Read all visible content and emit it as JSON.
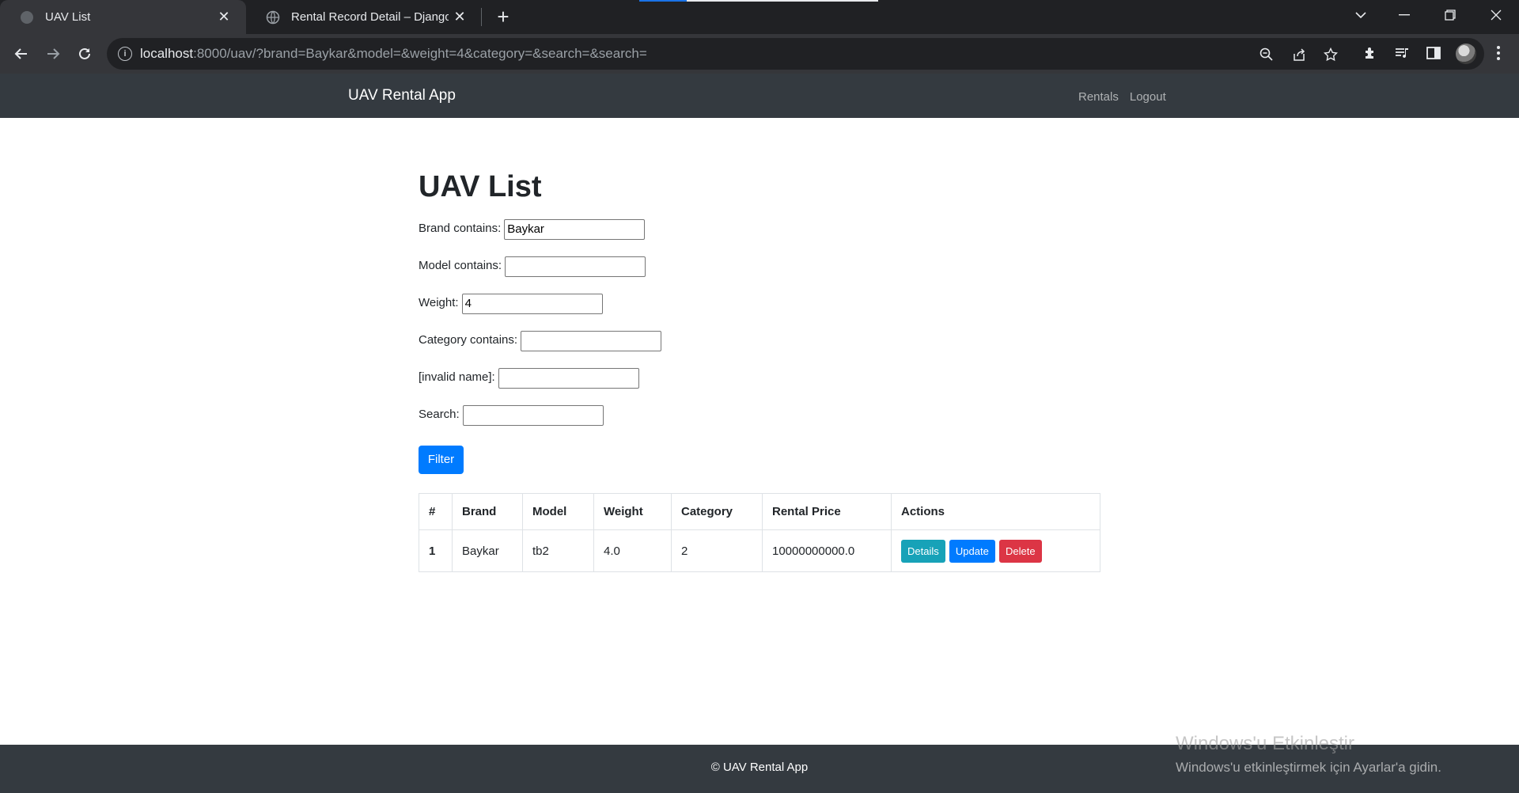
{
  "browser": {
    "tabs": [
      {
        "title": "UAV List"
      },
      {
        "title": "Rental Record Detail – Django RE"
      }
    ],
    "url_host": "localhost",
    "url_rest": ":8000/uav/?brand=Baykar&model=&weight=4&category=&search=&search="
  },
  "navbar": {
    "brand": "UAV Rental App",
    "links": [
      "Rentals",
      "Logout"
    ]
  },
  "page": {
    "title": "UAV List",
    "form": [
      {
        "label": "Brand contains:",
        "value": "Baykar"
      },
      {
        "label": "Model contains:",
        "value": ""
      },
      {
        "label": "Weight:",
        "value": "4"
      },
      {
        "label": "Category contains:",
        "value": ""
      },
      {
        "label": "[invalid name]:",
        "value": ""
      },
      {
        "label": "Search:",
        "value": ""
      }
    ],
    "filter_label": "Filter"
  },
  "table": {
    "headers": [
      "#",
      "Brand",
      "Model",
      "Weight",
      "Category",
      "Rental Price",
      "Actions"
    ],
    "rows": [
      {
        "num": "1",
        "brand": "Baykar",
        "model": "tb2",
        "weight": "4.0",
        "category": "2",
        "price": "10000000000.0"
      }
    ],
    "actions": [
      "Details",
      "Update",
      "Delete"
    ]
  },
  "footer": {
    "text": "© UAV Rental App"
  },
  "watermark": {
    "line1": "Windows'u Etkinleştir",
    "line2": "Windows'u etkinleştirmek için Ayarlar'a gidin."
  }
}
